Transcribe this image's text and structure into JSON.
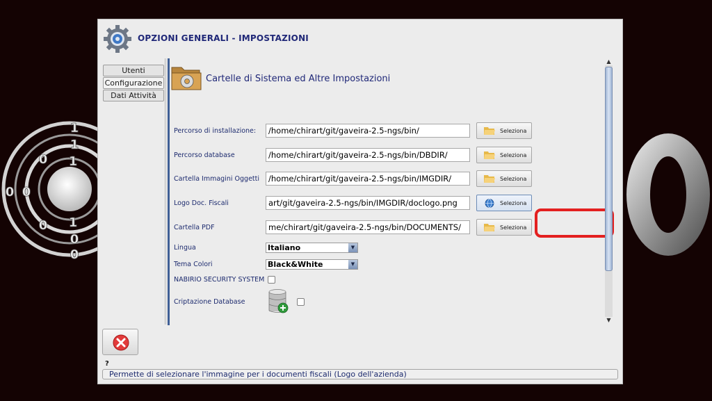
{
  "window": {
    "title": "OPZIONI GENERALI - IMPOSTAZIONI"
  },
  "side_tabs": [
    {
      "label": "Utenti"
    },
    {
      "label": "Configurazione"
    },
    {
      "label": "Dati Attività"
    }
  ],
  "panel": {
    "title": "Cartelle di Sistema ed Altre Impostazioni",
    "select_label": "Seleziona",
    "rows": [
      {
        "label": "Percorso di installazione:",
        "value": "/home/chirart/git/gaveira-2.5-ngs/bin/"
      },
      {
        "label": "Percorso database",
        "value": "/home/chirart/git/gaveira-2.5-ngs/bin/DBDIR/"
      },
      {
        "label": "Cartella Immagini Oggetti",
        "value": "/home/chirart/git/gaveira-2.5-ngs/bin/IMGDIR/"
      },
      {
        "label": "Logo Doc. Fiscali",
        "value": "art/git/gaveira-2.5-ngs/bin/IMGDIR/doclogo.png"
      },
      {
        "label": "Cartella PDF",
        "value": "me/chirart/git/gaveira-2.5-ngs/bin/DOCUMENTS/"
      }
    ],
    "lingua": {
      "label": "Lingua",
      "value": "Italiano"
    },
    "tema": {
      "label": "Tema Colori",
      "value": "Black&White"
    },
    "security": {
      "label": "NABIRIO SECURITY SYSTEM",
      "checked": false
    },
    "cripto": {
      "label": "Criptazione Database",
      "checked": false
    }
  },
  "help_mark": "?",
  "status_text": "Permette di selezionare l'immagine per i documenti fiscali (Logo dell'azienda)",
  "background_digits": [
    "1",
    "1",
    "0",
    "1",
    "0",
    "0",
    "0",
    "1",
    "0",
    "0"
  ],
  "icons": [
    "gear-icon",
    "folder-gear-icon",
    "folder-icon",
    "globe-icon",
    "database-icon",
    "close-icon",
    "chevron-down-icon",
    "scroll-up-icon",
    "scroll-down-icon"
  ],
  "colors": {
    "title": "#202878",
    "highlight": "#e32020",
    "accent": "#3f5f96"
  }
}
